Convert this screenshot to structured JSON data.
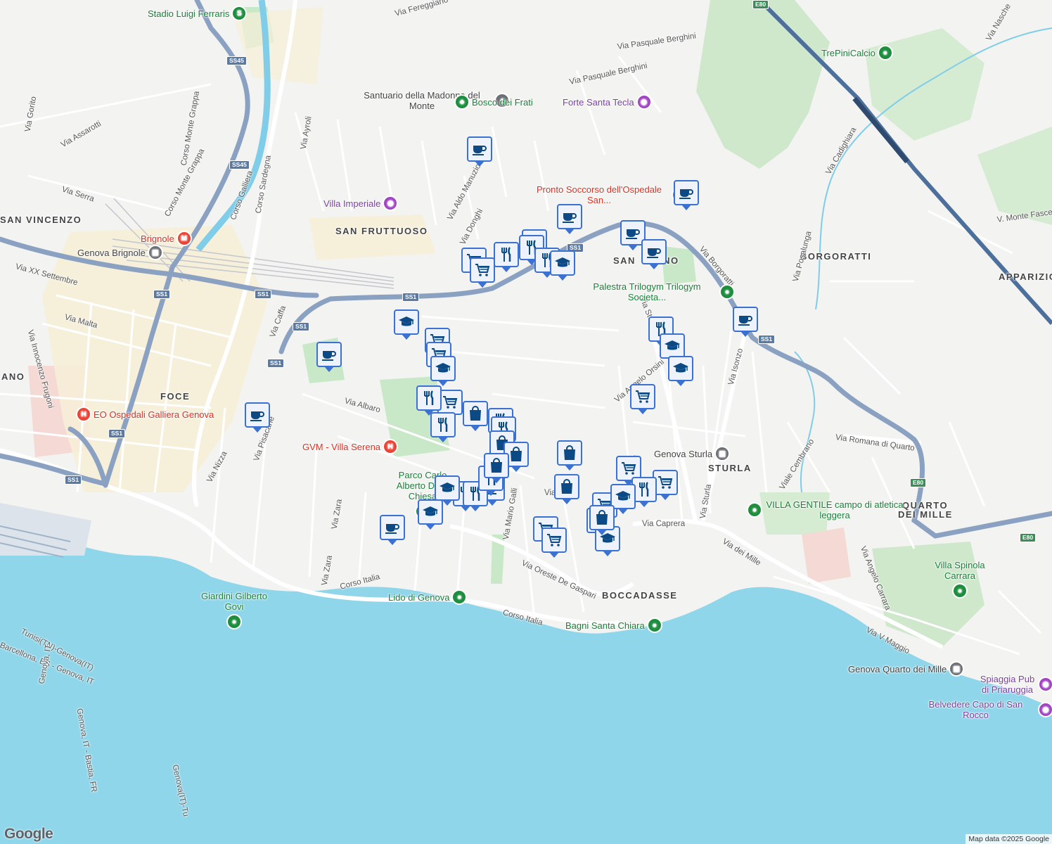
{
  "map": {
    "attribution": "Map data ©2025 Google",
    "logo": "Google",
    "colors": {
      "sea": "#8fd6ea",
      "land": "#f3f3f1",
      "park": "#c9e8c8",
      "highway": "#8aa1c2",
      "marker_border": "#3b71d1",
      "marker_fill": "#eef2fb",
      "marker_icon": "#0c4a85"
    }
  },
  "districts": [
    {
      "text": "SAN VINCENZO"
    },
    {
      "text": "SAN FRUTTUOSO"
    },
    {
      "text": "FOCE"
    },
    {
      "text": "BOCCADASSE"
    },
    {
      "text": "STURLA"
    },
    {
      "text": "BORGORATTI"
    },
    {
      "text": "QUARTO"
    },
    {
      "text": "DEI MILLE"
    },
    {
      "text": "APPARIZIO"
    },
    {
      "text": "ANO"
    },
    {
      "text": "SAN"
    },
    {
      "text": "INO"
    }
  ],
  "streets": [
    "Via Fereggiano",
    "Via Pasquale Berghini",
    "Via Pasquale Berghini",
    "Via Gorito",
    "Via Assarotti",
    "Corso Monte Grappa",
    "Corso Monte Grappa",
    "Via Serra",
    "Corso Galliera",
    "Corso Sardegna",
    "Via Ayroli",
    "Via Aldo Manuzio",
    "Via Donghi",
    "Via XX Settembre",
    "Via Malta",
    "Via Innocenzo Frugoni",
    "Via Caffa",
    "Via Albaro",
    "Via Nizza",
    "Via Pisacane",
    "Via Zara",
    "Via Zara",
    "Corso Italia",
    "Corso Italia",
    "Via Mario Galli",
    "Via Oreste De Gaspari",
    "Via Caprera",
    "Via dei Mille",
    "Via Sturla",
    "Via Sturla",
    "Via Angelo Orsini",
    "Orsini",
    "Via Isonzo",
    "Via Borgoratti",
    "Via Posalunga",
    "Via Cadighiara",
    "V. Monte Fasce",
    "Via Romana di Quarto",
    "Viale Cembrano",
    "Via Angelo Carrara",
    "Via V Maggio",
    "Via Nasche",
    "Via"
  ],
  "places": [
    {
      "text": "Stadio Luigi Ferraris",
      "kind": "green",
      "icon": "stadium-icon"
    },
    {
      "text": "Santuario della Madonna del Monte",
      "kind": "gray",
      "icon": "church-icon"
    },
    {
      "text": "Bosco dei Frati",
      "kind": "green",
      "icon": "tree-icon"
    },
    {
      "text": "Forte Santa Tecla",
      "kind": "purple",
      "icon": "camera-icon"
    },
    {
      "text": "Villa Imperiale",
      "kind": "purple",
      "icon": "camera-icon"
    },
    {
      "text": "Pronto Soccorso dell'Ospedale San...",
      "kind": "red",
      "icon": "hospital-icon"
    },
    {
      "text": "TrePiniCalcio",
      "kind": "green",
      "icon": "park-icon"
    },
    {
      "text": "Brignole",
      "kind": "red",
      "icon": "metro-icon"
    },
    {
      "text": "Genova Brignole",
      "kind": "gray",
      "icon": "train-icon"
    },
    {
      "text": "Palestra Trilogym Trilogym Societa...",
      "kind": "green",
      "icon": "gym-icon"
    },
    {
      "text": "EO Ospedali Galliera Genova",
      "kind": "red",
      "icon": "hospital-icon"
    },
    {
      "text": "GVM - Villa Serena",
      "kind": "red",
      "icon": "hospital-icon"
    },
    {
      "text": "Parco Carlo Alberto Dalla Chiesa",
      "kind": "green",
      "icon": "park-icon"
    },
    {
      "text": "Genova Sturla",
      "kind": "gray",
      "icon": "train-icon"
    },
    {
      "text": "VILLA GENTILE campo di atletica leggera",
      "kind": "green",
      "icon": "park-icon"
    },
    {
      "text": "Villa Spinola Carrara",
      "kind": "green",
      "icon": "park-icon"
    },
    {
      "text": "Giardini Gilberto Govi",
      "kind": "green",
      "icon": "park-icon"
    },
    {
      "text": "Lido di Genova",
      "kind": "green",
      "icon": "beach-icon"
    },
    {
      "text": "Bagni Santa Chiara",
      "kind": "green",
      "icon": "beach-icon"
    },
    {
      "text": "Genova Quarto dei Mille",
      "kind": "gray",
      "icon": "train-icon"
    },
    {
      "text": "Spiaggia Pub di Priaruggia",
      "kind": "purple",
      "icon": "camera-icon"
    },
    {
      "text": "Belvedere Capo di San Rocco",
      "kind": "purple",
      "icon": "camera-icon"
    }
  ],
  "shields": [
    "SS45",
    "SS45",
    "SS1",
    "SS1",
    "SS1",
    "SS1",
    "SS1",
    "SS1",
    "SS1",
    "SS1",
    "SS1",
    "E80",
    "E80",
    "E80"
  ],
  "sea_routes": [
    "Tunisi(TN)-Genova(IT)",
    "Barcellona, ES - Genova, IT",
    "Genova, IT - Bastia, FR",
    "Genova, IT",
    "Genova(IT)-Tu"
  ],
  "markers": [
    {
      "type": "cafe"
    },
    {
      "type": "cafe"
    },
    {
      "type": "cafe"
    },
    {
      "type": "cafe"
    },
    {
      "type": "cafe"
    },
    {
      "type": "cafe"
    },
    {
      "type": "cafe"
    },
    {
      "type": "cafe"
    },
    {
      "type": "cafe"
    },
    {
      "type": "cafe"
    },
    {
      "type": "cafe"
    },
    {
      "type": "grocery"
    },
    {
      "type": "grocery"
    },
    {
      "type": "grocery"
    },
    {
      "type": "grocery"
    },
    {
      "type": "grocery"
    },
    {
      "type": "grocery"
    },
    {
      "type": "grocery"
    },
    {
      "type": "grocery"
    },
    {
      "type": "grocery"
    },
    {
      "type": "grocery"
    },
    {
      "type": "grocery"
    },
    {
      "type": "grocery"
    },
    {
      "type": "restaurant"
    },
    {
      "type": "restaurant"
    },
    {
      "type": "restaurant"
    },
    {
      "type": "restaurant"
    },
    {
      "type": "restaurant"
    },
    {
      "type": "restaurant"
    },
    {
      "type": "restaurant"
    },
    {
      "type": "restaurant"
    },
    {
      "type": "restaurant"
    },
    {
      "type": "restaurant"
    },
    {
      "type": "restaurant"
    },
    {
      "type": "restaurant"
    },
    {
      "type": "school"
    },
    {
      "type": "school"
    },
    {
      "type": "school"
    },
    {
      "type": "school"
    },
    {
      "type": "school"
    },
    {
      "type": "school"
    },
    {
      "type": "school"
    },
    {
      "type": "school"
    },
    {
      "type": "school"
    },
    {
      "type": "shopping"
    },
    {
      "type": "shopping"
    },
    {
      "type": "shopping"
    },
    {
      "type": "shopping"
    },
    {
      "type": "shopping"
    },
    {
      "type": "shopping"
    },
    {
      "type": "shopping"
    }
  ]
}
